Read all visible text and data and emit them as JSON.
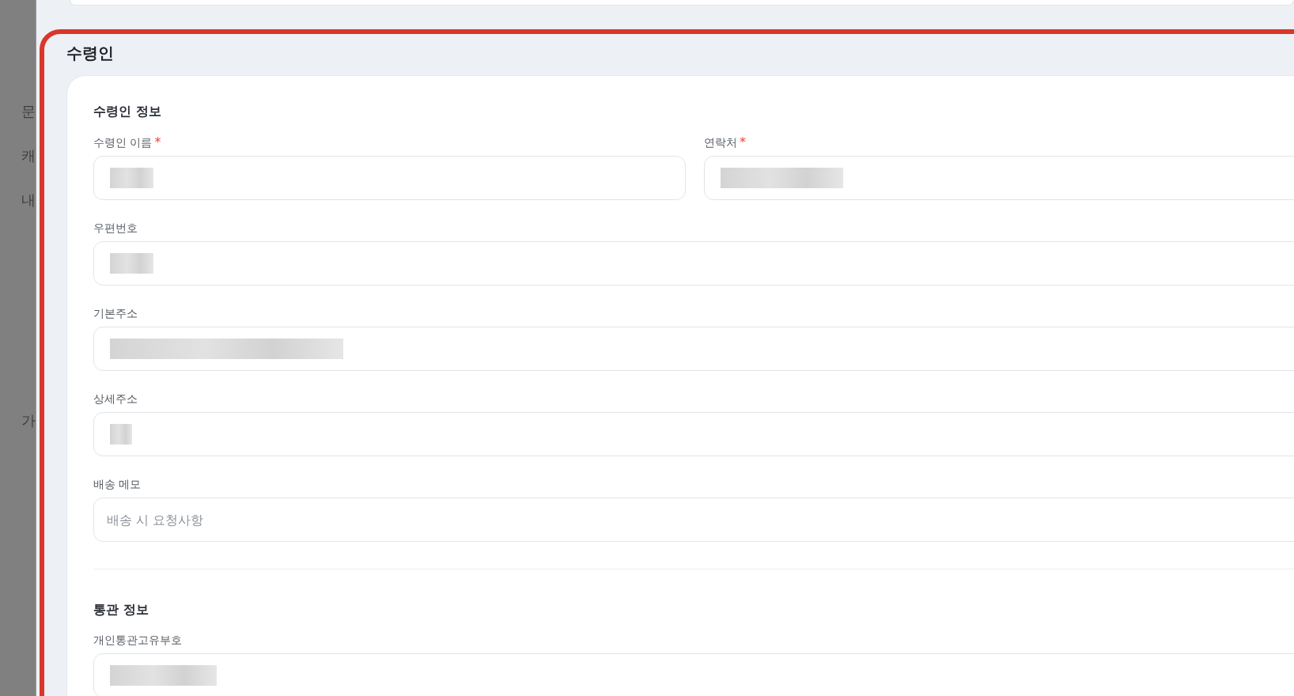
{
  "sidebar": {
    "items": [
      "문",
      "캐",
      "내",
      "가"
    ]
  },
  "section": {
    "title": "수령인",
    "groups": [
      {
        "title": "수령인 정보",
        "rows": [
          [
            {
              "label": "수령인 이름",
              "required_mark": "*",
              "kind": "redacted"
            },
            {
              "label": "연락처",
              "required_mark": "*",
              "kind": "redacted"
            }
          ],
          [
            {
              "label": "우편번호",
              "kind": "redacted"
            }
          ],
          [
            {
              "label": "기본주소",
              "kind": "redacted"
            }
          ],
          [
            {
              "label": "상세주소",
              "kind": "redacted"
            }
          ],
          [
            {
              "label": "배송 메모",
              "kind": "empty",
              "placeholder": "배송 시 요청사항"
            }
          ]
        ]
      },
      {
        "title": "통관 정보",
        "rows": [
          [
            {
              "label": "개인통관고유부호",
              "kind": "redacted"
            }
          ]
        ]
      }
    ]
  }
}
